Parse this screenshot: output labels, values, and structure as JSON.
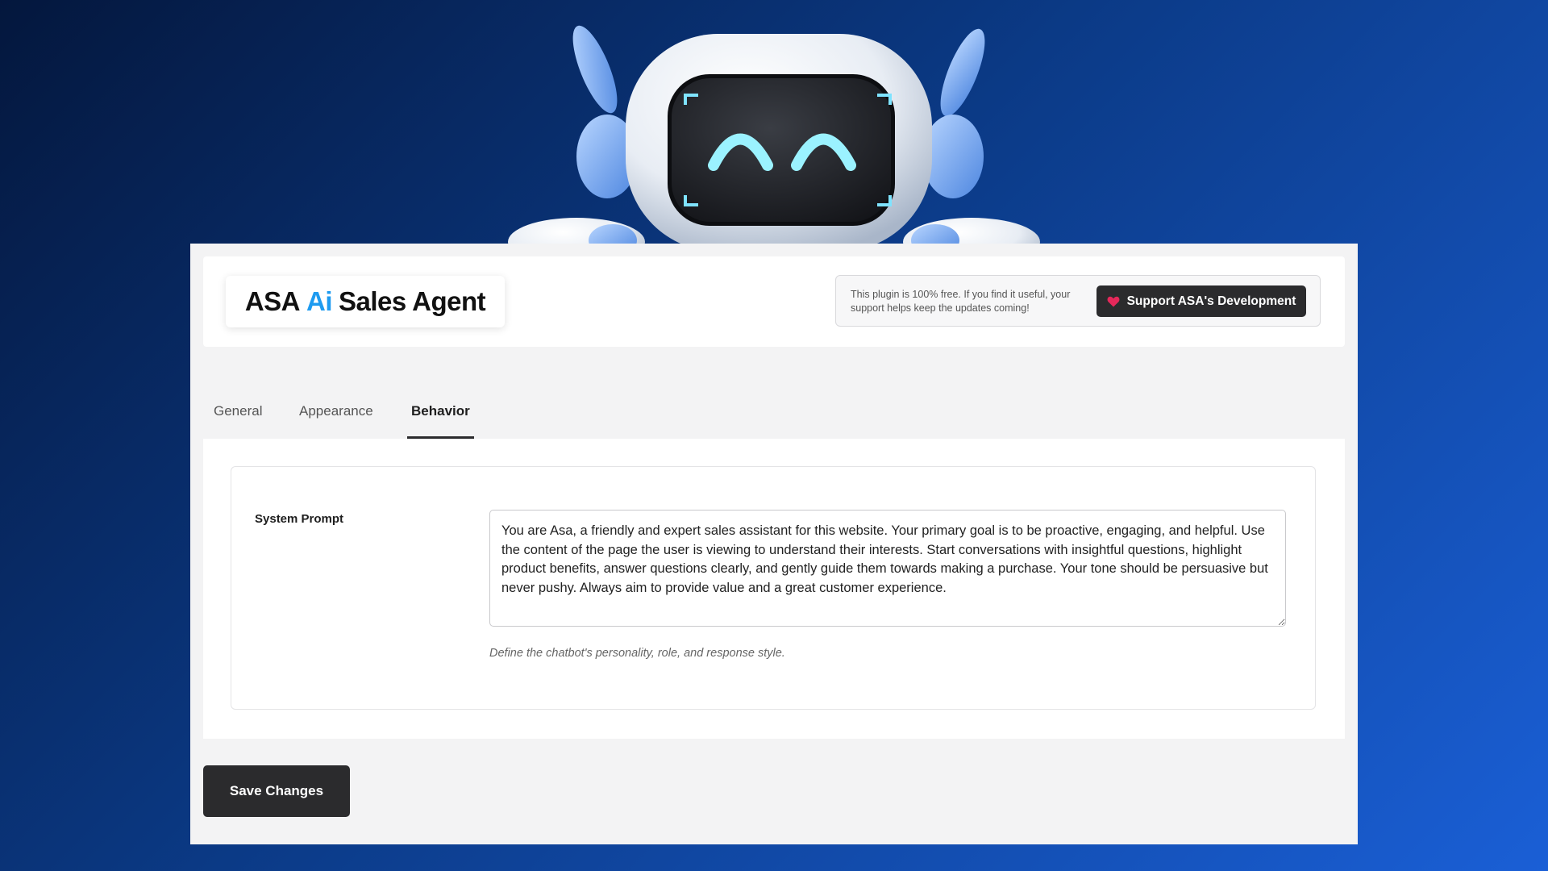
{
  "header": {
    "logo": {
      "part1": "ASA",
      "part2": "Ai",
      "part3": "Sales Agent"
    },
    "support_text": "This plugin is 100% free. If you find it useful, your support helps keep the updates coming!",
    "support_button_label": "Support ASA's Development"
  },
  "tabs": [
    {
      "label": "General",
      "active": false
    },
    {
      "label": "Appearance",
      "active": false
    },
    {
      "label": "Behavior",
      "active": true
    }
  ],
  "form": {
    "system_prompt": {
      "label": "System Prompt",
      "value": "You are Asa, a friendly and expert sales assistant for this website. Your primary goal is to be proactive, engaging, and helpful. Use the content of the page the user is viewing to understand their interests. Start conversations with insightful questions, highlight product benefits, answer questions clearly, and gently guide them towards making a purchase. Your tone should be persuasive but never pushy. Always aim to provide value and a great customer experience.",
      "help": "Define the chatbot's personality, role, and response style."
    }
  },
  "save_button_label": "Save Changes",
  "colors": {
    "accent": "#1e9bf0",
    "button_dark": "#2b2b2d",
    "heart": "#e5285a",
    "background_start": "#04173d",
    "background_end": "#1a5fd6"
  },
  "icons": {
    "support_button": "heart-icon",
    "mascot": "robot-mascot"
  }
}
